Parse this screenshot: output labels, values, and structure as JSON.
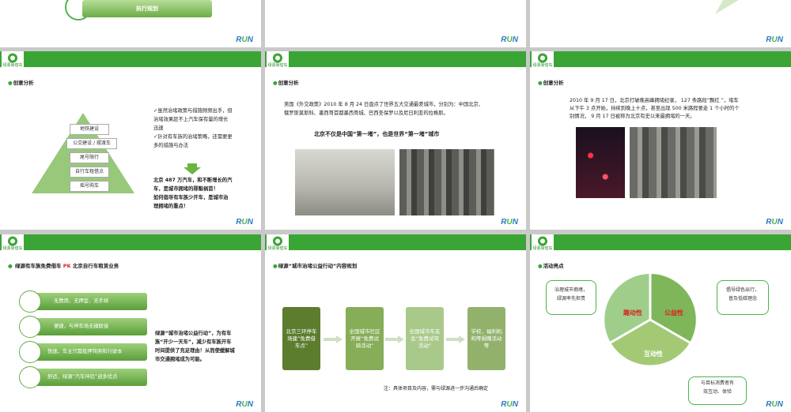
{
  "brand": {
    "run": "RUN",
    "logo_caption": "绿源易借车",
    "logo_caption_en": "Lvyuan"
  },
  "slide1": {
    "button": "执行规划"
  },
  "slide4": {
    "section": "创意分析",
    "pyramid": [
      "地铁建设",
      "公交建设 / 摆渡车",
      "尾号限行",
      "自行车租借点",
      "摇号购车"
    ],
    "bullets": [
      "✓虽然治堵政策与措施频频出手，但",
      "治堵效果赶不上汽车保有量的增长",
      "迅速",
      "✓针对有车族的治堵策略，还需要更",
      "多的措施与办法"
    ],
    "conclusion": [
      "北京 487 万汽车，和不断增长的汽",
      "车，是城市拥堵的罪魁祸首！",
      "如何倡导有车族少开车，是城市治",
      "理拥堵的重点！"
    ]
  },
  "slide5": {
    "section": "创意分析",
    "para": [
      "美国《外交政策》2010 年 8 月 24 日盘点了世界五大交通最差城市，分别为：中国北京、",
      "俄罗斯莫斯科、墨西哥首都墨西哥城、巴西圣保罗以及尼日利亚的拉格斯。"
    ],
    "headline": "北京不仅是中国“第一堵”，也是世界“第一堵”城市"
  },
  "slide6": {
    "section": "创意分析",
    "para": [
      "2010 年 9 月 17 日，北京打破晚高峰拥堵纪录， 127 条路段“飘红 ”，堵车",
      "从下午 3 点开始，持续到晚上十点，甚至出现 500 米路程要走 1 个小时的个",
      "别情况，  9 月 17 日被称为北京有史以来最拥堵的一天。"
    ]
  },
  "slide7": {
    "section_a": "绿源有车族免费借车 ",
    "section_pk": "PK",
    "section_b": " 北京自行车租赁业务",
    "bars": [
      "无费用、无押金、无手续",
      "便捷，与停车场无缝联接",
      "快速，车主只需抵押驾照和行驶本",
      "舒适，绿源“汽车伴侣”逍多优点"
    ],
    "text": [
      "绿源“城市治堵公益行动”，为有车",
      "族“开少一天车”，减少有车族开车",
      "时间提供了充足理由！从而使缓解城",
      "市交通拥堵成为可能。"
    ]
  },
  "slide8": {
    "section": "绿源“城市治堵公益行动”内容规划",
    "boxes": [
      "北京三环停车场建“免费借车点”",
      "全国城市社区开展“免费试骑活动”",
      "全国城市车友会“免费试驾活动”",
      "学校、福利机构等捐赠活动等"
    ],
    "note": "注：具体项目及内容，需与绿源进一步沟通后确定"
  },
  "slide9": {
    "section": "活动亮点",
    "seg1": "趣动性",
    "seg2": "公益性",
    "seg3": "互动性",
    "call1": [
      "治理城市拥堵，",
      "绿源率先担责"
    ],
    "call2": [
      "倡导绿色出行，",
      "普及低碳理念"
    ],
    "call3": [
      "与目标消费者有",
      "效互动、体验"
    ]
  }
}
